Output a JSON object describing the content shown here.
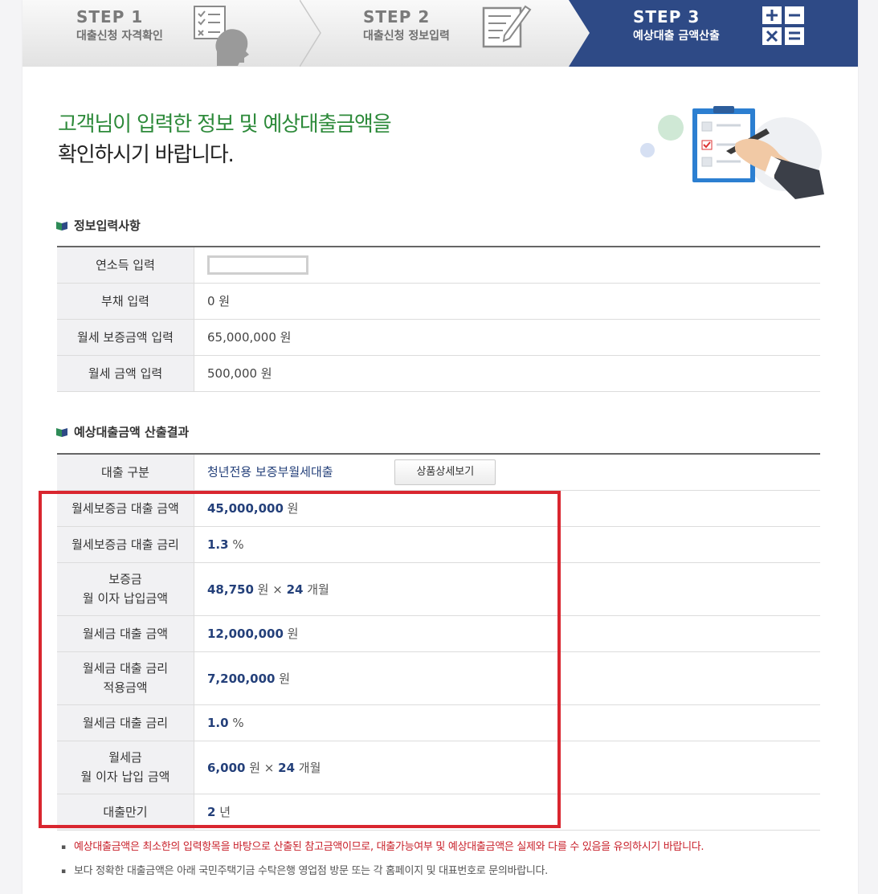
{
  "steps": [
    {
      "no": "STEP 1",
      "desc": "대출신청 자격확인",
      "icon": "checklist-person-icon"
    },
    {
      "no": "STEP 2",
      "desc": "대출신청 정보입력",
      "icon": "document-pen-icon"
    },
    {
      "no": "STEP 3",
      "desc": "예상대출 금액산출",
      "icon": "calculator-icon"
    }
  ],
  "headline": {
    "line1": "고객님이 입력한 정보 및 예상대출금액을",
    "line2": "확인하시기 바랍니다."
  },
  "section1": {
    "title": "정보입력사항",
    "rows": [
      {
        "label": "연소득 입력",
        "value": ""
      },
      {
        "label": "부채 입력",
        "value": "0 원"
      },
      {
        "label": "월세 보증금액 입력",
        "value": "65,000,000 원"
      },
      {
        "label": "월세 금액 입력",
        "value": "500,000 원"
      }
    ]
  },
  "section2": {
    "title": "예상대출금액 산출결과",
    "product_label": "대출 구분",
    "product_value": "청년전용 보증부월세대출",
    "detail_button": "상품상세보기",
    "rows": [
      {
        "label": "월세보증금 대출 금액",
        "num": "45,000,000",
        "unit": " 원"
      },
      {
        "label": "월세보증금 대출 금리",
        "num": "1.3",
        "unit": " %"
      },
      {
        "label1": "보증금",
        "label2": "월 이자 납입금액",
        "num": "48,750",
        "unit": " 원 × ",
        "num2": "24",
        "unit2": " 개월"
      },
      {
        "label": "월세금 대출 금액",
        "num": "12,000,000",
        "unit": " 원"
      },
      {
        "label1": "월세금 대출 금리",
        "label2": "적용금액",
        "num": "7,200,000",
        "unit": " 원"
      },
      {
        "label": "월세금 대출 금리",
        "num": "1.0",
        "unit": " %"
      },
      {
        "label1": "월세금",
        "label2": "월 이자 납입 금액",
        "num": "6,000",
        "unit": " 원 × ",
        "num2": "24",
        "unit2": " 개월"
      },
      {
        "label": "대출만기",
        "num": "2",
        "unit": " 년"
      }
    ]
  },
  "notes": [
    "예상대출금액은 최소한의 입력항목을 바탕으로 산출된 참고금액이므로, 대출가능여부 및 예상대출금액은 실제와 다를 수 있음을 유의하시기 바랍니다.",
    "보다 정확한 대출금액은 아래 국민주택기금 수탁은행 영업점 방문 또는 각 홈페이지 및 대표번호로 문의바랍니다."
  ],
  "colors": {
    "step_active": "#2e4a86",
    "headline_green": "#2d8a3a",
    "value_blue": "#24407a",
    "highlight_red": "#d9262f",
    "note_red": "#c8202a"
  }
}
